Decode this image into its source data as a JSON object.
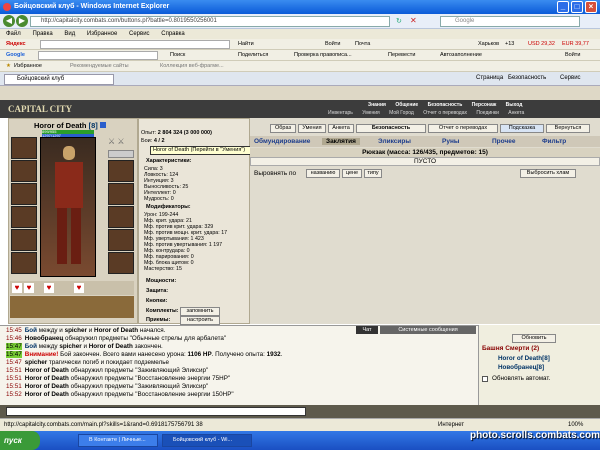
{
  "window": {
    "title": "Бойцовский клуб - Windows Internet Explorer",
    "min": "_",
    "max": "□",
    "close": "×"
  },
  "address": {
    "url": "http://capitalcity.combats.com/buttons.pl?battle=0.8019550256001",
    "search_placeholder": "Google"
  },
  "menu": [
    "Файл",
    "Правка",
    "Вид",
    "Избранное",
    "Сервис",
    "Справка"
  ],
  "yandex_bar": {
    "brand": "Яндекс",
    "find": "Найти",
    "login": "Войти",
    "mail": "Почта",
    "city": "Харьков",
    "temp": "+13",
    "usd": "USD 29,32",
    "eur": "EUR 39,77"
  },
  "google_bar": {
    "brand": "Google",
    "search": "Поиск",
    "share": "Поделиться",
    "check": "Проверка правописа...",
    "translate": "Перевести",
    "autofill": "Автозаполнение",
    "login": "Войти"
  },
  "fav_bar": {
    "favorites": "Избранное",
    "rec": "Рекомендуемые сайты",
    "gallery": "Коллекция веб-фрагме..."
  },
  "tab": {
    "title": "Бойцовский клуб",
    "page": "Страница",
    "safety": "Безопасность",
    "service": "Сервис"
  },
  "game": {
    "logo": "CAPITAL CITY",
    "nav1": [
      "Знания",
      "Общение",
      "Безопасность",
      "Персонаж",
      "Выход"
    ],
    "nav2": [
      "Инвентарь",
      "Умения",
      "Мой Город",
      "Отчет о переводах",
      "Поединки",
      "Анкета"
    ]
  },
  "char": {
    "name": "Horor of Death",
    "level": "[8]",
    "hp": "899/955",
    "mp": "1297/1297",
    "tooltip": "Horor of Death (Перейти в \"Умения\")",
    "exp_label": "Опыт:",
    "exp": "2 804 324 (3 000 000)",
    "battles_label": "Бои:",
    "battles": "4 / 2"
  },
  "stats": {
    "header": "Характеристики:",
    "items": [
      "Сила: 3",
      "Ловкость: 124",
      "Интуиция: 3",
      "Выносливость: 25",
      "Интеллект: 0",
      "Мудрость: 0"
    ],
    "mod_header": "Модификаторы:",
    "mods": [
      "Урон: 199-244",
      "Мф. крит. удара: 21",
      "Мф. против крит. удара: 329",
      "Мф. против мощн. крит. удара: 17",
      "Мф. увертывания: 1 423",
      "Мф. против увертывания: 1 197",
      "Мф. контрудара: 0",
      "Мф. парирования: 0",
      "Мф. блока щитом: 0",
      "Мастерство: 15"
    ],
    "more": [
      "Мощности:",
      "Защита:",
      "Кнопки:",
      "Комплекты:",
      "Приемы:"
    ],
    "remember": "запомнить",
    "settings": "настроить"
  },
  "inv": {
    "top_buttons": [
      "Образ",
      "Умения",
      "Анкета"
    ],
    "security": "Безопасность",
    "transfer": "Отчет о переводах",
    "hint": "Подсказка",
    "back": "Вернуться",
    "tabs": [
      "Обмундирование",
      "Заклятия",
      "Эликсиры",
      "Руны",
      "Прочее",
      "Фильтр"
    ],
    "backpack": "Рюкзак (масса: 126/435, предметов: 15)",
    "empty": "ПУСТО",
    "sort_label": "Выровнять по",
    "sort_buttons": [
      "названию",
      "цене",
      "типу"
    ],
    "discard": "Выбросить хлам"
  },
  "chat": {
    "tabs": [
      "Чат",
      "Системные сообщения"
    ],
    "lines": [
      {
        "t": "15:45",
        "a": "Бой",
        "b": " между и ",
        "c": "spicher",
        "d": " и ",
        "e": "Horor of Death",
        "f": " начался."
      },
      {
        "t": "15:46",
        "a": "Новобранец",
        "b": " обнаружил предметы \"Обычные стрелы для арбалета\""
      },
      {
        "t": "15:47",
        "a": "Бой",
        "b": " между ",
        "c": "spicher",
        "d": " и ",
        "e": "Horor of Death",
        "f": " закончен."
      },
      {
        "t": "15:47",
        "a": "Внимание!",
        "b": " Бой закончен. Всего вами нанесено урона: ",
        "c": "1106 HP",
        "d": ". Получено опыта: ",
        "e": "1932",
        "f": "."
      },
      {
        "t": "15:47",
        "a": "spicher",
        "b": " трагически погиб и покидает подземелье"
      },
      {
        "t": "15:51",
        "a": "Horor of Death",
        "b": " обнаружил предметы \"Заживляющий Эликсир\""
      },
      {
        "t": "15:51",
        "a": "Horor of Death",
        "b": " обнаружил предметы \"Восстановление энергии 75HP\""
      },
      {
        "t": "15:51",
        "a": "Horor of Death",
        "b": " обнаружил предметы \"Заживляющий Эликсир\""
      },
      {
        "t": "15:52",
        "a": "Horor of Death",
        "b": " обнаружил предметы \"Восстановление энергии 150HP\""
      }
    ]
  },
  "room": {
    "refresh": "Обновить",
    "title": "Башня Смерти (2)",
    "players": [
      {
        "name": "Horor of Death",
        "lvl": "[8]"
      },
      {
        "name": "Новобранец",
        "lvl": "[8]"
      }
    ],
    "auto": "Обновлять автомат."
  },
  "status": {
    "text": "http://capitalcity.combats.com/main.pl?skills=1&rand=0.6918175756791 38",
    "zone": "Интернет",
    "zoom": "100%"
  },
  "taskbar": {
    "start": "пуск",
    "tasks": [
      "В Контакте | Личные...",
      "Бойцовский клуб - Wi..."
    ],
    "clock": "15:53"
  },
  "watermark": "photo.scrolls.combats.com"
}
